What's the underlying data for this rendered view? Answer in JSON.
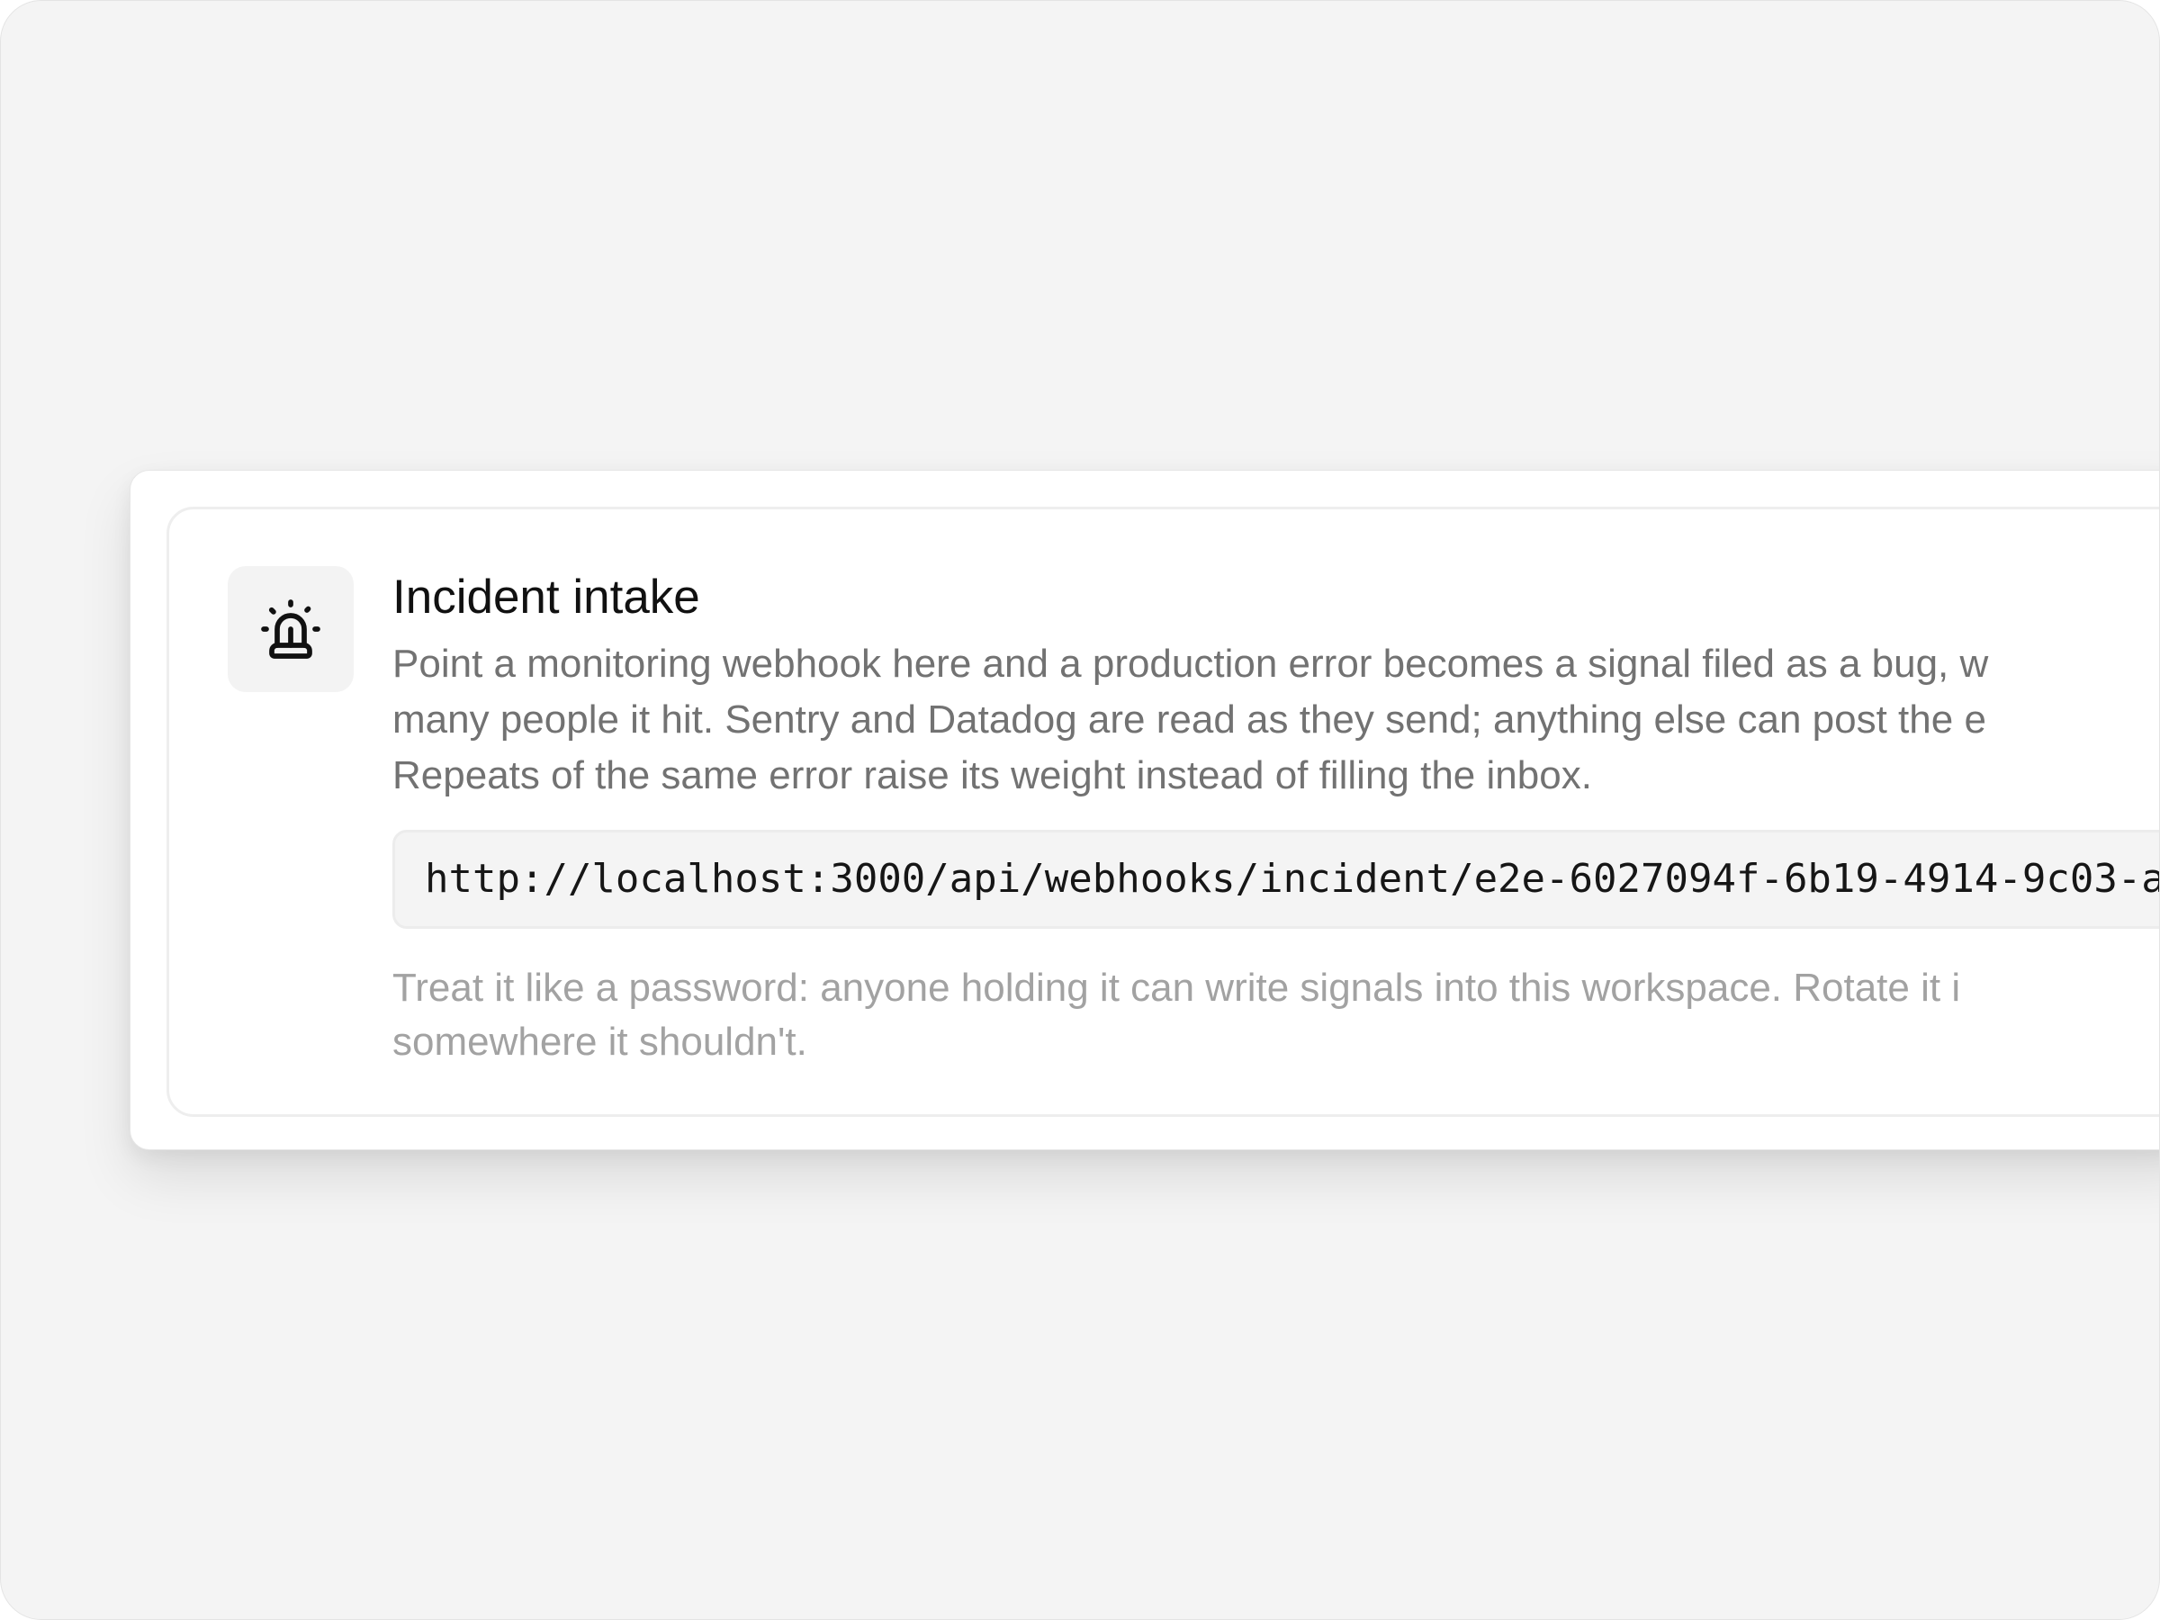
{
  "card": {
    "icon": "siren-icon",
    "title": "Incident intake",
    "description_lines": [
      "Point a monitoring webhook here and a production error becomes a signal filed as a bug, w",
      "many people it hit. Sentry and Datadog are read as they send; anything else can post the e",
      "Repeats of the same error raise its weight instead of filling the inbox."
    ],
    "webhook_url": "http://localhost:3000/api/webhooks/incident/e2e-6027094f-6b19-4914-9c03-a",
    "hint_lines": [
      "Treat it like a password: anyone holding it can write signals into this workspace. Rotate it i",
      "somewhere it shouldn't."
    ]
  },
  "colors": {
    "background": "#f4f4f4",
    "card": "#ffffff",
    "title": "#111111",
    "description": "#727272",
    "hint": "#a2a2a2",
    "url_box": "#f4f4f4"
  }
}
